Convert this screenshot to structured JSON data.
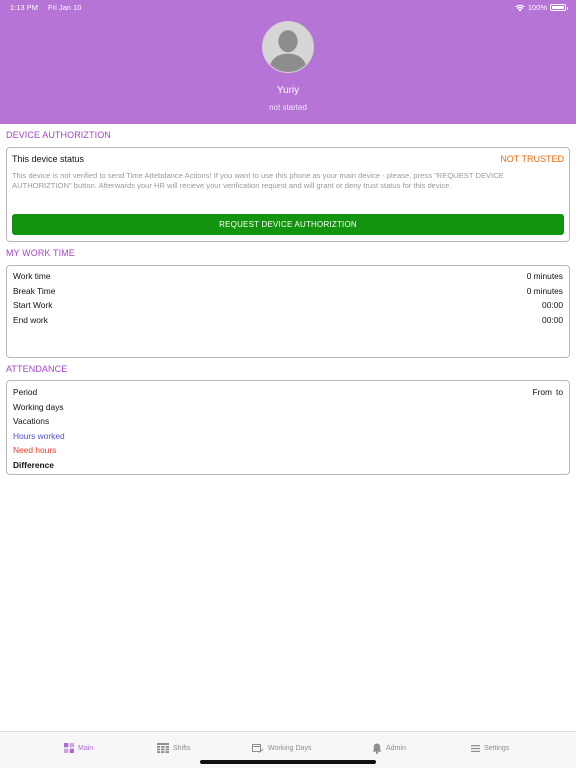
{
  "status_bar": {
    "time": "1:13 PM",
    "date": "Fri Jan 10",
    "battery": "100%"
  },
  "profile": {
    "name": "Yuriy",
    "status": "not started"
  },
  "device_auth": {
    "title": "DEVICE AUTHORIZTION",
    "status_label": "This device status",
    "status_value": "NOT TRUSTED",
    "description": "This device is not verified to send Time Attebdance Actions! If you want to use this phone as your main device - please, press \"REQUEST DEVICE AUTHORIZTION\" button. Afterwards your HR will recieve your verification request and will grant or deny trust status for this device.",
    "button_label": "REQUEST DEVICE AUTHORIZTION"
  },
  "work_time": {
    "title": "MY WORK TIME",
    "rows": [
      {
        "label": "Work time",
        "value": "0 minutes"
      },
      {
        "label": "Break Time",
        "value": "0 minutes"
      },
      {
        "label": "Start Work",
        "value": "00:00"
      },
      {
        "label": "End work",
        "value": "00:00"
      }
    ]
  },
  "attendance": {
    "title": "ATTENDANCE",
    "period_label": "Period",
    "period_from": "From",
    "period_to": "to",
    "rows": [
      {
        "label": "Working days"
      },
      {
        "label": "Vacations"
      },
      {
        "label": "Hours worked"
      },
      {
        "label": "Need hours"
      },
      {
        "label": "Difference"
      }
    ]
  },
  "tabs": [
    {
      "label": "Main",
      "icon": "grid-icon",
      "active": true
    },
    {
      "label": "Shifts",
      "icon": "table-icon",
      "active": false
    },
    {
      "label": "Working Days",
      "icon": "calendar-plane-icon",
      "active": false
    },
    {
      "label": "Admin",
      "icon": "bell-icon",
      "active": false
    },
    {
      "label": "Settings",
      "icon": "menu-lines-icon",
      "active": false
    }
  ],
  "colors": {
    "header": "#b574d6",
    "section_title": "#a246c8",
    "not_trusted": "#ea6a12",
    "button": "#12940f",
    "hours_worked": "#4b4fd8",
    "need_hours": "#ee3b2a"
  }
}
